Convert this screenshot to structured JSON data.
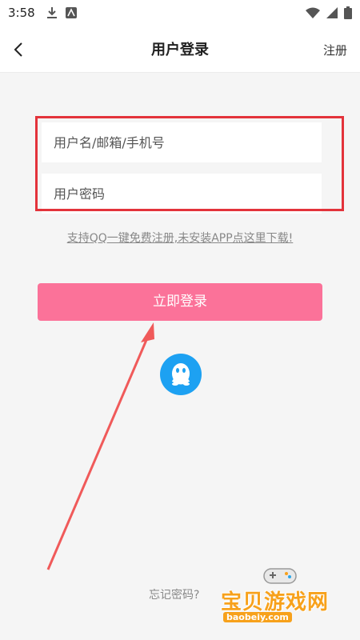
{
  "status_bar": {
    "time": "3:58",
    "icons_left": [
      "download-icon",
      "android-icon"
    ],
    "icons_right": [
      "wifi-icon",
      "signal-icon",
      "battery-icon"
    ]
  },
  "header": {
    "title": "用户登录",
    "register_label": "注册"
  },
  "form": {
    "username_placeholder": "用户名/邮箱/手机号",
    "password_placeholder": "用户密码"
  },
  "qq_register_link": "支持QQ一键免费注册,未安装APP点这里下载!",
  "login_button": "立即登录",
  "forgot_password": "忘记密码?",
  "watermark": {
    "title": "宝贝游戏网",
    "url": "baobeiy.com"
  },
  "colors": {
    "accent": "#fb7299",
    "qq_blue": "#1da1f2",
    "annotation_red": "#e3333b"
  }
}
